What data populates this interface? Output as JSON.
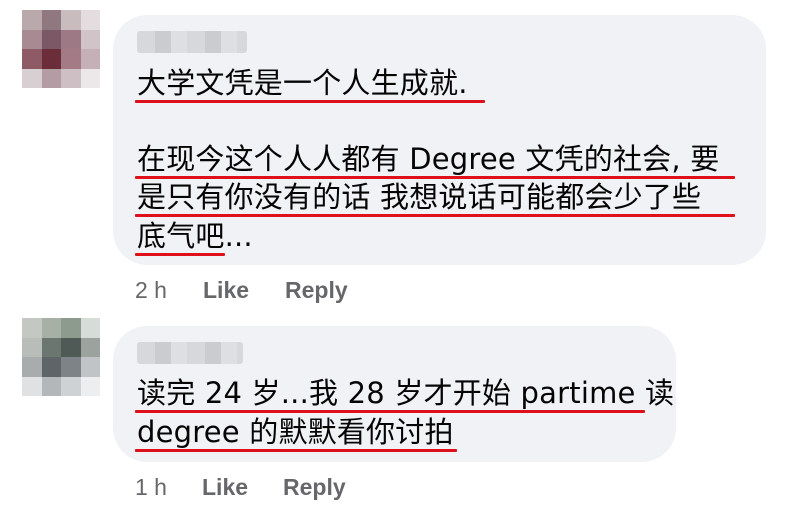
{
  "comments": [
    {
      "lines": [
        "大学文凭是一个人生成就.",
        "",
        "在现今这个人人都有 Degree 文凭的社会, 要",
        "是只有你没有的话 我想说话可能都会少了些",
        "底气吧..."
      ],
      "time": "2 h",
      "like": "Like",
      "reply": "Reply"
    },
    {
      "lines": [
        "读完 24 岁...我 28 岁才开始 partime 读",
        "degree 的默默看你讨拍"
      ],
      "time": "1 h",
      "like": "Like",
      "reply": "Reply"
    }
  ],
  "colors": {
    "underline": "#e0101a",
    "bubble": "#f0f2f5",
    "meta": "#65676b",
    "text": "#050505"
  }
}
